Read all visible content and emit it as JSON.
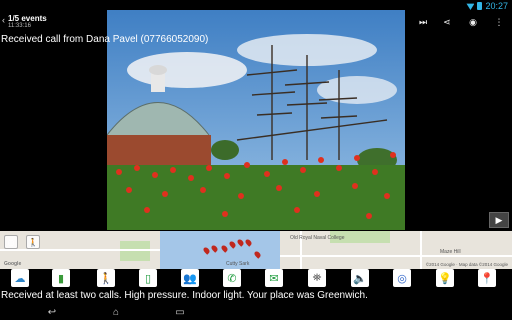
{
  "status_bar": {
    "time": "20:27"
  },
  "action_bar": {
    "title": "1/5 events",
    "subtitle": "11:33:16"
  },
  "caption": "Received call from Dana Pavel (07766052090)",
  "map": {
    "labels": [
      "Cutty Sark",
      "Old Royal Naval College",
      "Maze Hill",
      "©2014 Google · Map data ©2014 Google"
    ],
    "logo": "Google"
  },
  "summary": "Received at least two calls. High pressure. Indoor light. Your place was Greenwich.",
  "icons": [
    "weather-icon",
    "battery-icon",
    "walking-icon",
    "phone-screen-icon",
    "people-icon",
    "phone-call-icon",
    "sms-icon",
    "transport-icon",
    "signal-tower-icon",
    "sound-icon",
    "pressure-icon",
    "light-icon",
    "location-icon"
  ]
}
